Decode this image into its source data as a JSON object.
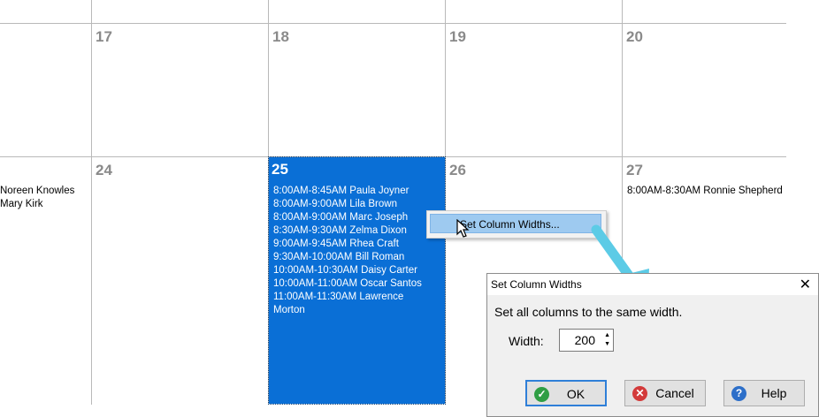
{
  "calendar": {
    "days": {
      "d17": "17",
      "d18": "18",
      "d19": "19",
      "d20": "20",
      "d24": "24",
      "d25": "25",
      "d26": "26",
      "d27": "27"
    },
    "left_column_appts": [
      "Noreen Knowles",
      "Mary Kirk"
    ],
    "day25_appts": [
      "8:00AM-8:45AM Paula Joyner",
      "8:00AM-9:00AM Lila Brown",
      "8:00AM-9:00AM Marc Joseph",
      "8:30AM-9:30AM Zelma Dixon",
      "9:00AM-9:45AM Rhea Craft",
      "9:30AM-10:00AM Bill Roman",
      "10:00AM-10:30AM Daisy Carter",
      "10:00AM-11:00AM Oscar Santos",
      "11:00AM-11:30AM Lawrence",
      "Morton"
    ],
    "day27_appts": [
      "8:00AM-8:30AM Ronnie Shepherd"
    ]
  },
  "context_menu": {
    "item": "Set Column Widths..."
  },
  "dialog": {
    "title": "Set Column Widths",
    "message": "Set all columns to the same width.",
    "width_label": "Width:",
    "width_value": "200",
    "ok": "OK",
    "cancel": "Cancel",
    "help": "Help"
  },
  "colors": {
    "selection": "#0a6fd6",
    "menu_highlight": "#9ecaf0",
    "arrow": "#5ccbe6"
  },
  "icons": [
    "close-icon",
    "check-icon",
    "cancel-icon",
    "help-icon",
    "spin-up-icon",
    "spin-down-icon",
    "mouse-cursor-icon",
    "pointer-arrow-icon"
  ]
}
